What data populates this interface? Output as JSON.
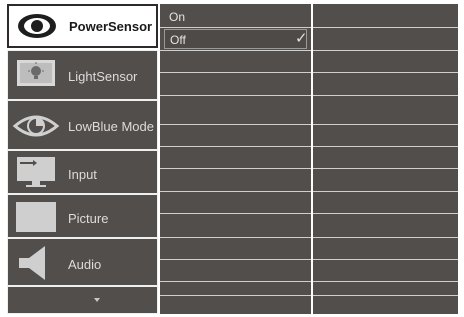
{
  "menu": {
    "items": [
      {
        "label": "PowerSensor",
        "icon": "eye-icon",
        "selected": true
      },
      {
        "label": "LightSensor",
        "icon": "light-sensor-icon",
        "selected": false
      },
      {
        "label": "LowBlue Mode",
        "icon": "low-blue-eye-icon",
        "selected": false
      },
      {
        "label": "Input",
        "icon": "input-icon",
        "selected": false
      },
      {
        "label": "Picture",
        "icon": "picture-icon",
        "selected": false
      },
      {
        "label": "Audio",
        "icon": "speaker-icon",
        "selected": false
      }
    ],
    "more_icon": "chevron-down-icon"
  },
  "options": {
    "items": [
      {
        "label": "On",
        "checked": false
      },
      {
        "label": "Off",
        "checked": true
      }
    ],
    "check_glyph": "✓"
  },
  "colors": {
    "panel": "#524e4b",
    "divider": "#cfcfcf",
    "selected_bg": "#ffffff",
    "text": "#dcdcdc"
  }
}
